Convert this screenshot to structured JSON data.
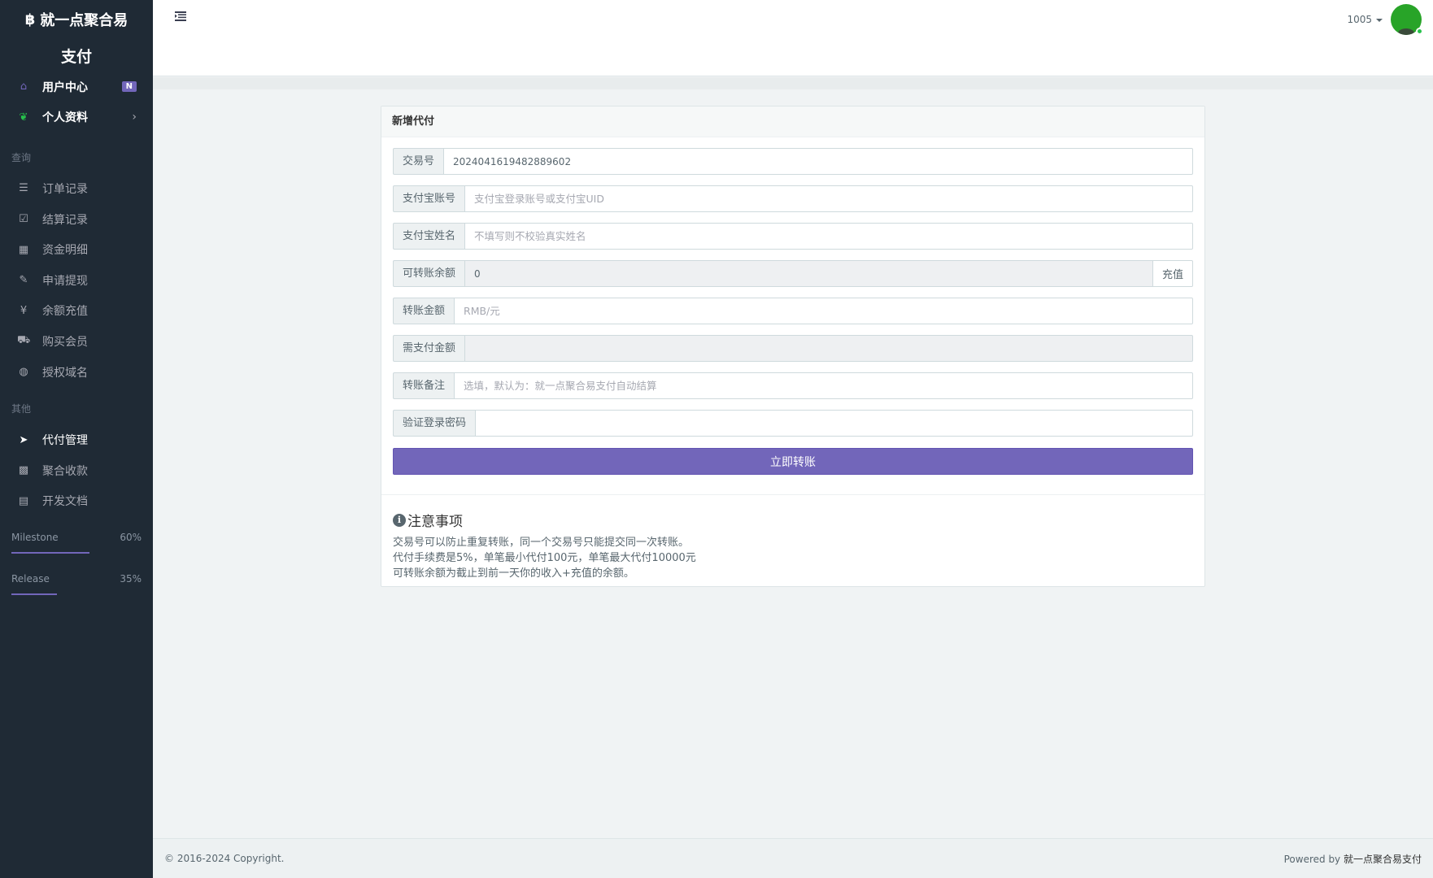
{
  "brand": {
    "logo_icon": "bitcoin-icon",
    "name": "就一点聚合易",
    "sub": "支付"
  },
  "sidebar": {
    "items_top": [
      {
        "name": "home",
        "icon": "home-icon",
        "glyph": "⌂",
        "label": "用户中心",
        "badge": "N"
      },
      {
        "name": "profile",
        "icon": "leaf-icon",
        "glyph": "❦",
        "label": "个人资料",
        "chevron": "›"
      }
    ],
    "header_query": "查询",
    "items_query": [
      {
        "name": "orders",
        "icon": "list-icon",
        "glyph": "☰",
        "label": "订单记录"
      },
      {
        "name": "settlement",
        "icon": "check-square-icon",
        "glyph": "☑",
        "label": "结算记录"
      },
      {
        "name": "funds",
        "icon": "calendar-icon",
        "glyph": "▦",
        "label": "资金明细"
      },
      {
        "name": "withdraw",
        "icon": "edit-icon",
        "glyph": "✎",
        "label": "申请提现"
      },
      {
        "name": "recharge",
        "icon": "yen-icon",
        "glyph": "¥",
        "label": "余额充值"
      },
      {
        "name": "vip",
        "icon": "cart-icon",
        "glyph": "⛟",
        "label": "购买会员"
      },
      {
        "name": "domain",
        "icon": "globe-icon",
        "glyph": "◍",
        "label": "授权域名"
      }
    ],
    "header_other": "其他",
    "items_other": [
      {
        "name": "payout",
        "icon": "paper-plane-icon",
        "glyph": "➤",
        "label": "代付管理",
        "active": true
      },
      {
        "name": "aggregate",
        "icon": "qrcode-icon",
        "glyph": "▩",
        "label": "聚合收款"
      },
      {
        "name": "docs",
        "icon": "book-icon",
        "glyph": "▤",
        "label": "开发文档"
      }
    ],
    "progress": [
      {
        "label": "Milestone",
        "value_text": "60%",
        "value": 0.6,
        "color": "#7266ba"
      },
      {
        "label": "Release",
        "value_text": "35%",
        "value": 0.35,
        "color": "#7266ba"
      }
    ]
  },
  "header": {
    "menu_icon": "indent-icon",
    "user_name": "1005",
    "avatar_color": "#28a428",
    "status_color": "#27c24c"
  },
  "panel": {
    "title": "新增代付",
    "fields": {
      "trade_no": {
        "label": "交易号",
        "value": "2024041619482889602"
      },
      "alipay_account": {
        "label": "支付宝账号",
        "placeholder": "支付宝登录账号或支付宝UID"
      },
      "alipay_name": {
        "label": "支付宝姓名",
        "placeholder": "不填写则不校验真实姓名"
      },
      "balance": {
        "label": "可转账余额",
        "value": "0",
        "button": "充值"
      },
      "amount": {
        "label": "转账金额",
        "placeholder": "RMB/元"
      },
      "need_pay": {
        "label": "需支付金额",
        "value": ""
      },
      "remark": {
        "label": "转账备注",
        "placeholder": "选填，默认为：就一点聚合易支付自动结算"
      },
      "password": {
        "label": "验证登录密码",
        "value": ""
      }
    },
    "submit": "立即转账",
    "notes": {
      "title": "注意事项",
      "lines": [
        "交易号可以防止重复转账，同一个交易号只能提交同一次转账。",
        "代付手续费是5%，单笔最小代付100元，单笔最大代付10000元",
        "可转账余额为截止到前一天你的收入+充值的余额。"
      ]
    }
  },
  "footer": {
    "copyright": "© 2016-2024 Copyright.",
    "powered_prefix": "Powered by ",
    "powered_name": "就一点聚合易支付"
  }
}
